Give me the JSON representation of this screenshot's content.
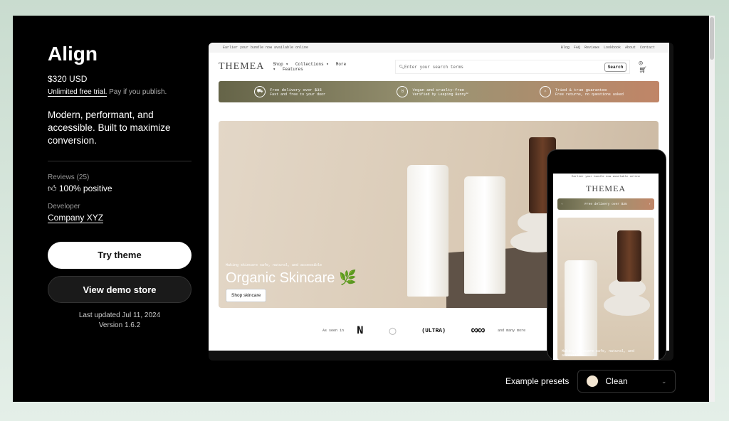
{
  "theme": {
    "name": "Align",
    "price": "$320 USD",
    "trial_link": "Unlimited free trial.",
    "trial_note": " Pay if you publish.",
    "description": "Modern, performant, and accessible. Built to maximize conversion.",
    "reviews_label": "Reviews (25)",
    "reviews_value": "100% positive",
    "developer_label": "Developer",
    "developer_name": "Company XYZ",
    "try_label": "Try theme",
    "demo_label": "View demo store",
    "last_updated": "Last updated Jul 11, 2024",
    "version": "Version 1.6.2"
  },
  "preview": {
    "announcement": "Earlier your bundle now available online",
    "top_links": [
      "Blog",
      "FAQ",
      "Reviews",
      "Lookbook",
      "About",
      "Contact"
    ],
    "logo": "THEMEA",
    "nav": [
      "Shop ▾",
      "Collections ▾",
      "More ▾",
      "Features"
    ],
    "search_placeholder": "Enter your search terms",
    "search_button": "Search",
    "benefits": [
      {
        "title": "Free delivery over $35",
        "sub": "Fast and free to your door"
      },
      {
        "title": "Vegan and cruelty-free",
        "sub": "Verified by Leaping Bunny™"
      },
      {
        "title": "Tried & true guarantee",
        "sub": "Free returns, no questions asked"
      }
    ],
    "hero_tag": "Making skincare safe, natural, and accessible",
    "hero_title": "Organic Skincare 🌿",
    "hero_button": "Shop skincare",
    "seen_in": "As seen in",
    "and_more": "and many more"
  },
  "mobile": {
    "announcement": "Earlier your bundle now available online",
    "logo": "THEMEA",
    "band": "Free delivery over $35",
    "hero_tag": "Making skincare safe, natural, and accessible"
  },
  "presets": {
    "label": "Example presets",
    "selected": "Clean",
    "swatch": "#f3e6d2"
  }
}
